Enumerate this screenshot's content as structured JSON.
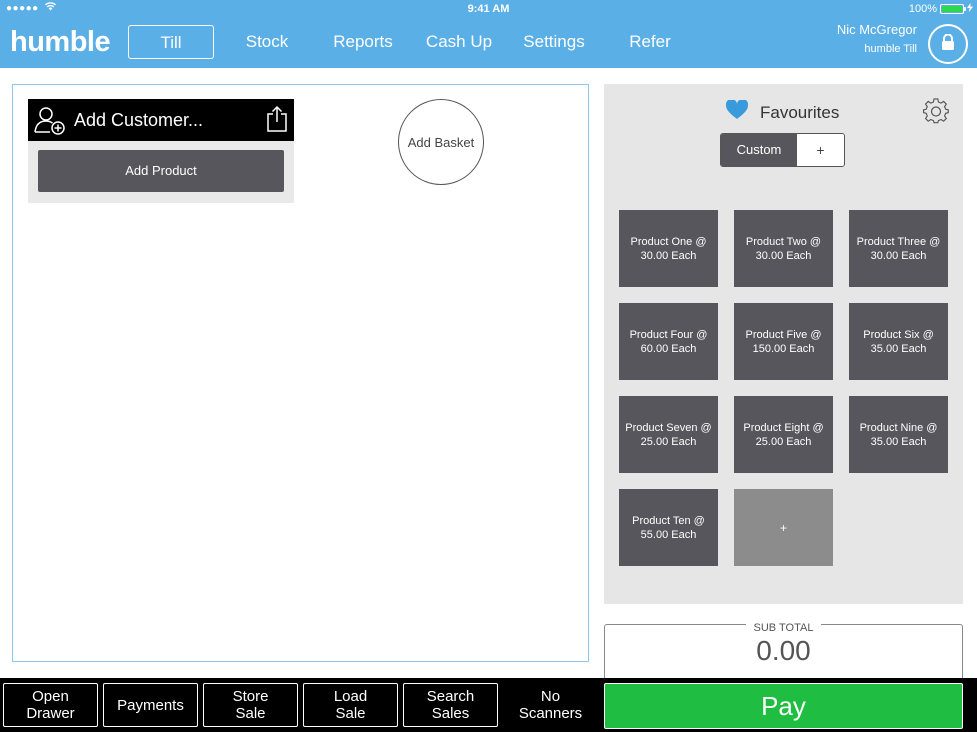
{
  "status_bar": {
    "signal": "●●●●●",
    "time": "9:41 AM",
    "battery_text": "100%",
    "battery_level": 1.0
  },
  "header": {
    "logo": "humble",
    "nav": [
      {
        "label": "Till",
        "active": true
      },
      {
        "label": "Stock"
      },
      {
        "label": "Reports"
      },
      {
        "label": "Cash Up"
      },
      {
        "label": "Settings"
      },
      {
        "label": "Refer"
      }
    ],
    "user_name": "Nic McGregor",
    "store_name": "humble Till"
  },
  "basket": {
    "customer_label": "Add Customer...",
    "add_product_label": "Add Product",
    "add_basket_label": "Add Basket"
  },
  "favourites": {
    "title": "Favourites",
    "segment_custom": "Custom",
    "segment_plus": "+",
    "tiles": [
      {
        "label": "Product One @ 30.00 Each"
      },
      {
        "label": "Product Two @ 30.00 Each"
      },
      {
        "label": "Product Three @ 30.00 Each"
      },
      {
        "label": "Product Four @ 60.00 Each"
      },
      {
        "label": "Product Five @ 150.00 Each"
      },
      {
        "label": "Product Six @ 35.00 Each"
      },
      {
        "label": "Product Seven @ 25.00 Each"
      },
      {
        "label": "Product Eight @ 25.00 Each"
      },
      {
        "label": "Product Nine @ 35.00 Each"
      },
      {
        "label": "Product Ten @ 55.00 Each"
      }
    ],
    "add_tile_label": "+"
  },
  "subtotal": {
    "label": "SUB TOTAL",
    "value": "0.00"
  },
  "bottom_bar": {
    "open_drawer": "Open Drawer",
    "payments": "Payments",
    "store_sale": "Store Sale",
    "load_sale": "Load Sale",
    "search_sales": "Search Sales",
    "no_scanners": "No Scanners",
    "pay": "Pay"
  },
  "colors": {
    "header_blue": "#5aafe6",
    "pay_green": "#1fbd41",
    "tile_grey": "#56565c",
    "heart_blue": "#3a9bdc"
  }
}
